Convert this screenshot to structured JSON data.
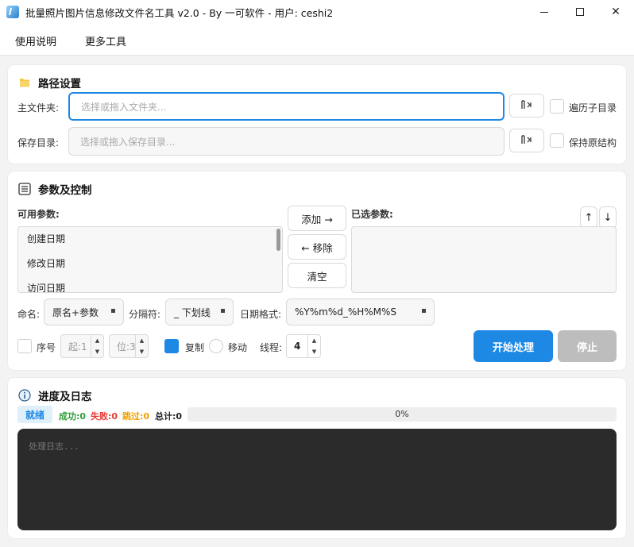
{
  "window": {
    "title": "批量照片图片信息修改文件名工具 v2.0 - By 一可软件 - 用户: ceshi2",
    "min_glyph": "",
    "close_glyph": "✕"
  },
  "menu": {
    "items": [
      "使用说明",
      "更多工具"
    ]
  },
  "path_section": {
    "title": "路径设置",
    "main_folder_label": "主文件夹:",
    "main_folder_placeholder": "选择或拖入文件夹...",
    "save_dir_label": "保存目录:",
    "save_dir_placeholder": "选择或拖入保存目录...",
    "recurse_label": "遍历子目录",
    "keep_structure_label": "保持原结构"
  },
  "params_section": {
    "title": "参数及控制",
    "available_label": "可用参数:",
    "available_items": [
      "创建日期",
      "修改日期",
      "访问日期"
    ],
    "selected_label": "已选参数:",
    "add_label": "添加 →",
    "remove_label": "← 移除",
    "clear_label": "清空",
    "up_label": "↑",
    "down_label": "↓",
    "naming_label": "命名:",
    "naming_value": "原名+参数",
    "separator_label": "分隔符:",
    "separator_value": "_ 下划线",
    "date_format_label": "日期格式:",
    "date_format_value": "%Y%m%d_%H%M%S",
    "seq_label": "序号",
    "start_placeholder": "起:1",
    "digits_placeholder": "位:3",
    "copy_label": "复制",
    "move_label": "移动",
    "threads_label": "线程:",
    "threads_value": "4",
    "start_button": "开始处理",
    "stop_button": "停止"
  },
  "progress_section": {
    "title": "进度及日志",
    "status": "就绪",
    "success": "成功:0",
    "fail": "失败:0",
    "skip": "跳过:0",
    "total": "总计:0",
    "progress_percent": 0,
    "progress_text": "0%",
    "log_placeholder": "处理日志..."
  },
  "colors": {
    "accent": "#1e88e5",
    "success": "#2e9d3a",
    "fail": "#e53935",
    "skip": "#f0a000",
    "log_bg": "#2b2b2b"
  }
}
